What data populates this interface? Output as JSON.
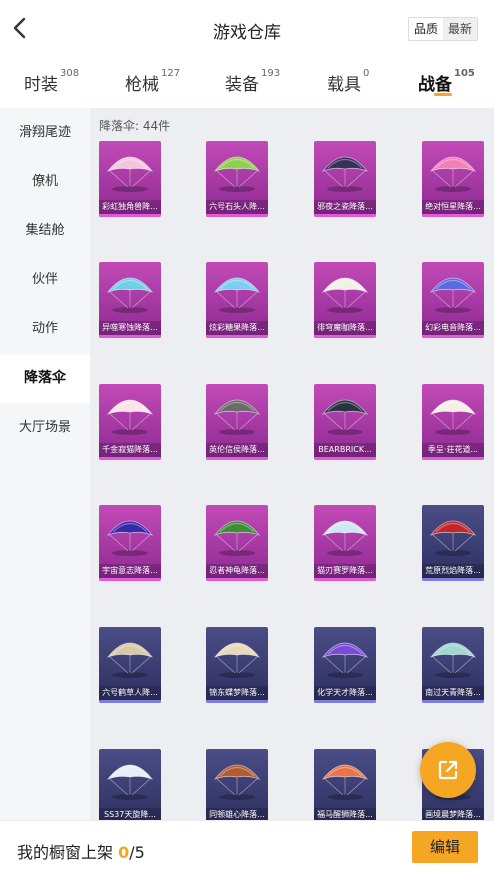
{
  "header": {
    "title": "游戏仓库",
    "sort_options": [
      "品质",
      "最新"
    ],
    "active_sort": "品质"
  },
  "tabs": [
    {
      "label": "时装",
      "count": "308"
    },
    {
      "label": "枪械",
      "count": "127"
    },
    {
      "label": "装备",
      "count": "193"
    },
    {
      "label": "载具",
      "count": "0"
    },
    {
      "label": "战备",
      "count": "105",
      "active": true
    }
  ],
  "sidebar": {
    "items": [
      {
        "label": "滑翔尾迹"
      },
      {
        "label": "僚机"
      },
      {
        "label": "集结舱"
      },
      {
        "label": "伙伴"
      },
      {
        "label": "动作"
      },
      {
        "label": "降落伞",
        "active": true
      },
      {
        "label": "大厅场景"
      }
    ]
  },
  "content": {
    "count_label": "降落伞: 44件",
    "items": [
      {
        "name": "彩虹独角兽降...",
        "tier": "legend",
        "color": "#f2c6de"
      },
      {
        "name": "六号石头人降...",
        "tier": "legend",
        "color": "#8fd14f"
      },
      {
        "name": "邪夜之瓷降落...",
        "tier": "legend",
        "color": "#3a2f5c"
      },
      {
        "name": "绝对恒星降落...",
        "tier": "legend",
        "color": "#f27fb6"
      },
      {
        "name": "异噬寒蚀降落...",
        "tier": "legend",
        "color": "#6fd0e6"
      },
      {
        "name": "炫彩糖果降落...",
        "tier": "legend",
        "color": "#7ccff0"
      },
      {
        "name": "徘穹魔咖降落...",
        "tier": "legend",
        "color": "#f0efe8"
      },
      {
        "name": "幻彩电音降落...",
        "tier": "legend",
        "color": "#5a6be0"
      },
      {
        "name": "千金寂猫降落...",
        "tier": "legend",
        "color": "#fbe3ea"
      },
      {
        "name": "英伦信侯降落...",
        "tier": "legend",
        "color": "#6b6b6b"
      },
      {
        "name": "BEARBRICK...",
        "tier": "legend",
        "color": "#2a3440"
      },
      {
        "name": "季呈·荘花道...",
        "tier": "legend",
        "color": "#f6efe6"
      },
      {
        "name": "宇宙意志降落...",
        "tier": "legend",
        "color": "#3b2aa8"
      },
      {
        "name": "忍者神龟降落...",
        "tier": "legend",
        "color": "#3f8c3a"
      },
      {
        "name": "猫刃赛罗降落...",
        "tier": "legend",
        "color": "#cfe6f5"
      },
      {
        "name": "荒原烈焰降落...",
        "tier": "epic",
        "color": "#c0262b"
      },
      {
        "name": "六号鹤草人降...",
        "tier": "epic",
        "color": "#d9c9a6"
      },
      {
        "name": "锦东蝶梦降落...",
        "tier": "epic",
        "color": "#e8d7b8"
      },
      {
        "name": "化学天才降落...",
        "tier": "epic",
        "color": "#7a4ad8"
      },
      {
        "name": "南过天青降落...",
        "tier": "epic",
        "color": "#9fd8d0"
      },
      {
        "name": "SS37天旋降...",
        "tier": "epic",
        "color": "#e6eef8"
      },
      {
        "name": "同顿雄心降落...",
        "tier": "epic",
        "color": "#b35a2e"
      },
      {
        "name": "福马醒狮降落...",
        "tier": "epic",
        "color": "#e8744a"
      },
      {
        "name": "画境晨梦降落...",
        "tier": "epic",
        "color": "#6fa0d8"
      }
    ]
  },
  "bottom": {
    "showcase_label": "我的橱窗上架",
    "current": "0",
    "separator_total": "/5",
    "edit_label": "编辑"
  },
  "colors": {
    "accent": "#f5a623",
    "legend_tier": "#b03aa8",
    "epic_tier": "#3c3f75"
  },
  "icons": {
    "back": "chevron-left-icon",
    "share": "share-external-icon"
  }
}
